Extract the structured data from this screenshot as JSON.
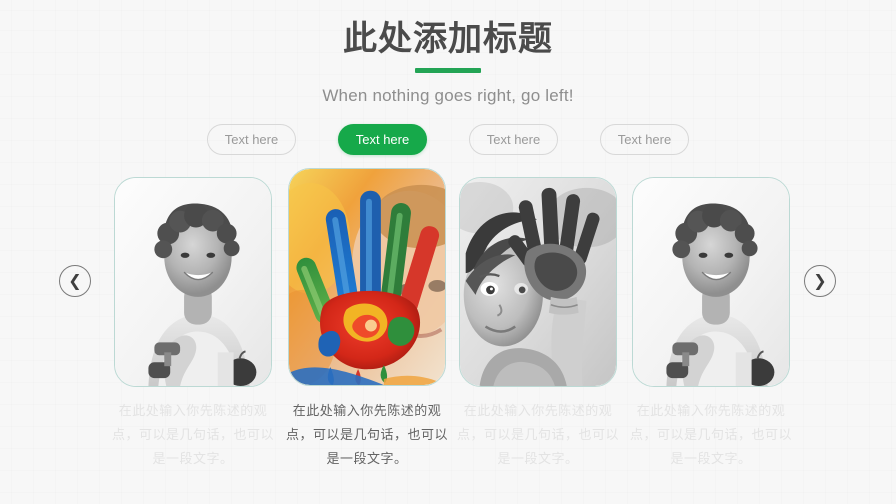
{
  "header": {
    "title": "此处添加标题",
    "subtitle": "When nothing goes right, go left!"
  },
  "tabs": [
    {
      "label": "Text here",
      "state": "inactive"
    },
    {
      "label": "Text here",
      "state": "active"
    },
    {
      "label": "Text here",
      "state": "inactive"
    },
    {
      "label": "Text here",
      "state": "inactive"
    }
  ],
  "colors": {
    "accent_green": "#16a94a",
    "underline_green": "#23a455",
    "title_gray": "#4b4b4b",
    "subtitle_gray": "#8e8e8e",
    "card_border": "#bcd9d4",
    "background": "#f7f7f7"
  },
  "cards": [
    {
      "image": "fitness-woman-dumbbell-grayscale",
      "caption": "在此处输入你先陈述的观点，可以是几句话，也可以是一段文字。",
      "state": "inactive"
    },
    {
      "image": "painted-hands-child-color",
      "caption": "在此处输入你先陈述的观点，可以是几句话，也可以是一段文字。",
      "state": "active"
    },
    {
      "image": "painted-hands-boy-grayscale",
      "caption": "在此处输入你先陈述的观点，可以是几句话，也可以是一段文字。",
      "state": "inactive"
    },
    {
      "image": "fitness-woman-dumbbell-grayscale",
      "caption": "在此处输入你先陈述的观点，可以是几句话，也可以是一段文字。",
      "state": "inactive"
    }
  ],
  "nav": {
    "prev_glyph": "❮",
    "next_glyph": "❯"
  }
}
